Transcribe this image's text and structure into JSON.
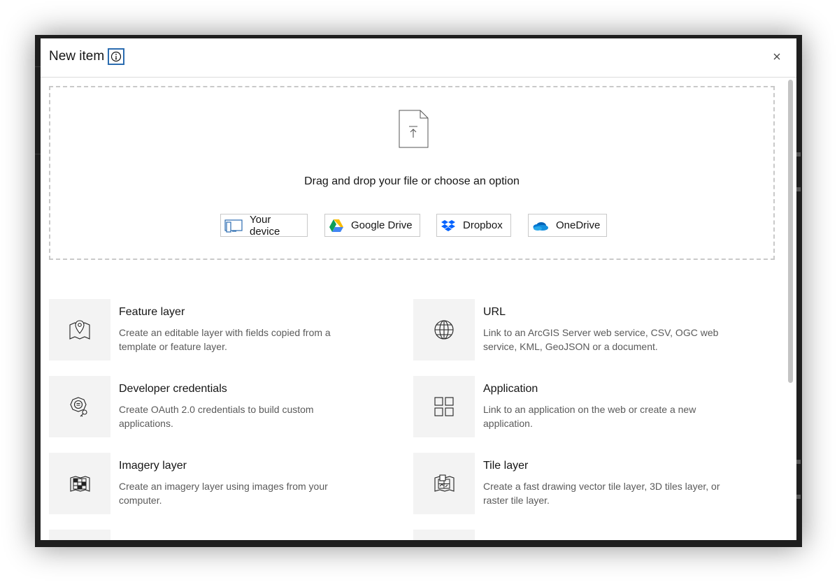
{
  "dialog": {
    "title": "New item"
  },
  "dropzone": {
    "prompt": "Drag and drop your file or choose an option",
    "sources": [
      {
        "label": "Your device",
        "icon": "device-icon"
      },
      {
        "label": "Google Drive",
        "icon": "google-drive-icon"
      },
      {
        "label": "Dropbox",
        "icon": "dropbox-icon"
      },
      {
        "label": "OneDrive",
        "icon": "onedrive-icon"
      }
    ]
  },
  "items": [
    {
      "title": "Feature layer",
      "description": "Create an editable layer with fields copied from a template or feature layer.",
      "icon": "map-pin-icon"
    },
    {
      "title": "URL",
      "description": "Link to an ArcGIS Server web service, CSV, OGC web service, KML, GeoJSON or a document.",
      "icon": "globe-icon"
    },
    {
      "title": "Developer credentials",
      "description": "Create OAuth 2.0 credentials to build custom applications.",
      "icon": "credentials-icon"
    },
    {
      "title": "Application",
      "description": "Link to an application on the web or create a new application.",
      "icon": "grid-icon"
    },
    {
      "title": "Imagery layer",
      "description": "Create an imagery layer using images from your computer.",
      "icon": "imagery-icon"
    },
    {
      "title": "Tile layer",
      "description": "Create a fast drawing vector tile layer, 3D tiles layer, or raster tile layer.",
      "icon": "tile-layer-icon"
    }
  ],
  "colors": {
    "accent": "#2b6cb0",
    "icon_tile_bg": "#f3f3f3",
    "backdrop": "#1e1e1e"
  }
}
